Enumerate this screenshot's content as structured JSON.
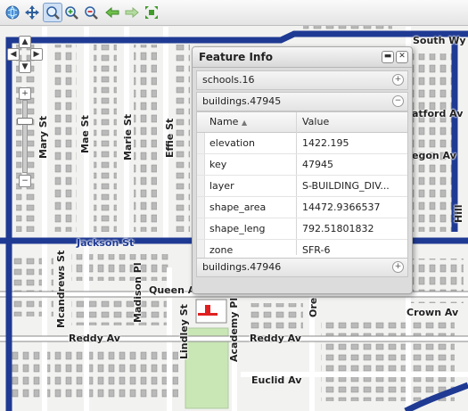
{
  "toolbar": {
    "tools": [
      {
        "icon": "globe-icon"
      },
      {
        "icon": "pan-icon"
      },
      {
        "icon": "zoom-box-icon",
        "active": true
      },
      {
        "icon": "zoom-in-icon"
      },
      {
        "icon": "zoom-out-icon"
      },
      {
        "icon": "back-arrow-icon"
      },
      {
        "icon": "forward-arrow-icon"
      },
      {
        "icon": "zoom-extent-icon"
      }
    ]
  },
  "map": {
    "labels": {
      "south_wy": "South Wy",
      "mary_st": "Mary St",
      "mae_st": "Mae St",
      "marie_st": "Marie St",
      "effie_st": "Effie St",
      "mcandrews_st": "Mcandrews St",
      "madison_pl": "Madison Pl",
      "queen_av": "Queen Av",
      "lindley_st": "Lindley St",
      "academy_pl": "Academy Pl",
      "crown_av": "Crown Av",
      "reddy_av_left": "Reddy Av",
      "reddy_av_right": "Reddy Av",
      "euclid_av": "Euclid Av",
      "ore": "Ore",
      "stratford_av": "atford Av",
      "oregon_av": "egon Av",
      "hillside": "Hill",
      "jackson_st": "Jackson St"
    },
    "colors": {
      "highway": "#1f3a93",
      "street": "#ffffff",
      "building": "#b9b9b9",
      "park": "#c9e6b5",
      "background": "#f2f2f0"
    }
  },
  "feature_info": {
    "title": "Feature Info",
    "groups": {
      "schools": "schools.16",
      "buildings_open": "buildings.47945",
      "buildings_next": "buildings.47946"
    },
    "table": {
      "columns": {
        "name": "Name",
        "value": "Value"
      },
      "rows": [
        {
          "name": "elevation",
          "value": "1422.195"
        },
        {
          "name": "key",
          "value": "47945"
        },
        {
          "name": "layer",
          "value": "S-BUILDING_DIV..."
        },
        {
          "name": "shape_area",
          "value": "14472.9366537"
        },
        {
          "name": "shape_leng",
          "value": "792.51801832"
        },
        {
          "name": "zone",
          "value": "SFR-6"
        }
      ]
    }
  }
}
